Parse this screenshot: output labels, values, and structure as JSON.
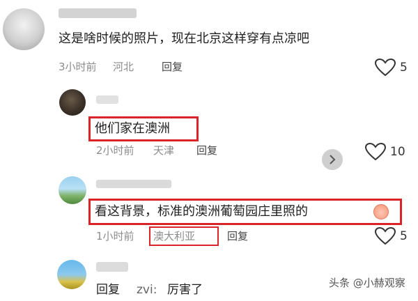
{
  "comments": [
    {
      "text": "这是啥时候的照片，现在北京这样穿有点凉吧",
      "time": "3小时前",
      "location": "河北",
      "reply_label": "回复",
      "likes": "5"
    },
    {
      "text": "他们家在澳洲",
      "time": "2小时前",
      "location": "天津",
      "reply_label": "回复",
      "likes": "10"
    },
    {
      "text": "看这背景，标准的澳洲葡萄园庄里照的",
      "time": "1小时前",
      "location": "澳大利亚",
      "reply_label": "回复",
      "likes": "5"
    },
    {
      "text": "回复",
      "reply_to": "zvi:",
      "reply_text": "厉害了"
    }
  ],
  "watermark": {
    "text": "头条 @小赫观察"
  },
  "colors": {
    "highlight": "#d9252a",
    "meta_text": "#8c8c8c",
    "body_text": "#1e1e1e"
  }
}
